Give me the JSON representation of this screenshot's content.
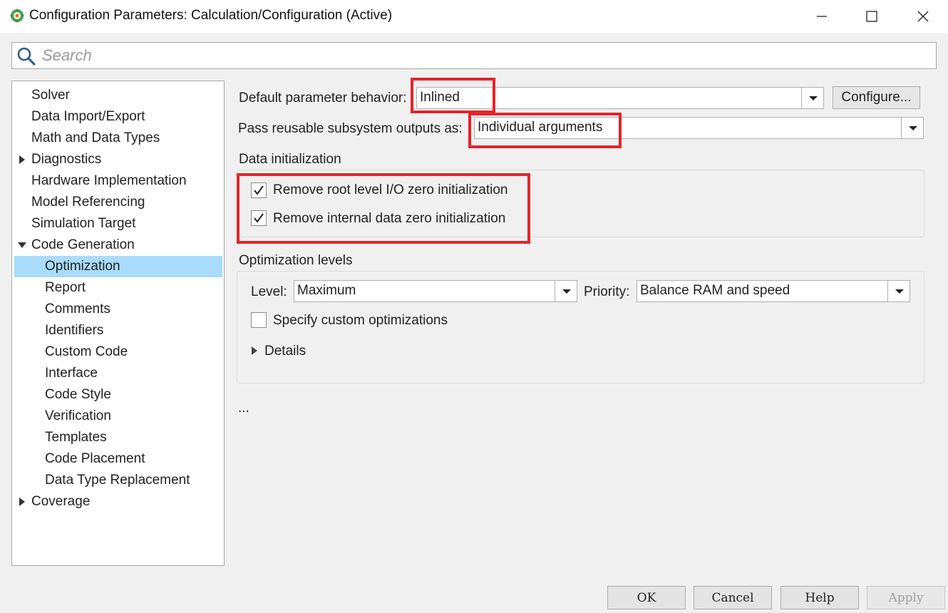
{
  "window": {
    "title": "Configuration Parameters: Calculation/Configuration (Active)",
    "minimize_icon": "minimize-icon",
    "maximize_icon": "maximize-icon",
    "close_icon": "close-icon"
  },
  "search": {
    "placeholder": "Search",
    "value": ""
  },
  "tree": {
    "items": [
      {
        "label": "Solver",
        "level": 0,
        "expander": "none"
      },
      {
        "label": "Data Import/Export",
        "level": 0,
        "expander": "none"
      },
      {
        "label": "Math and Data Types",
        "level": 0,
        "expander": "none"
      },
      {
        "label": "Diagnostics",
        "level": 0,
        "expander": "collapsed"
      },
      {
        "label": "Hardware Implementation",
        "level": 0,
        "expander": "none"
      },
      {
        "label": "Model Referencing",
        "level": 0,
        "expander": "none"
      },
      {
        "label": "Simulation Target",
        "level": 0,
        "expander": "none"
      },
      {
        "label": "Code Generation",
        "level": 0,
        "expander": "expanded"
      },
      {
        "label": "Optimization",
        "level": 1,
        "expander": "none",
        "selected": true
      },
      {
        "label": "Report",
        "level": 1,
        "expander": "none"
      },
      {
        "label": "Comments",
        "level": 1,
        "expander": "none"
      },
      {
        "label": "Identifiers",
        "level": 1,
        "expander": "none"
      },
      {
        "label": "Custom Code",
        "level": 1,
        "expander": "none"
      },
      {
        "label": "Interface",
        "level": 1,
        "expander": "none"
      },
      {
        "label": "Code Style",
        "level": 1,
        "expander": "none"
      },
      {
        "label": "Verification",
        "level": 1,
        "expander": "none"
      },
      {
        "label": "Templates",
        "level": 1,
        "expander": "none"
      },
      {
        "label": "Code Placement",
        "level": 1,
        "expander": "none"
      },
      {
        "label": "Data Type Replacement",
        "level": 1,
        "expander": "none"
      },
      {
        "label": "Coverage",
        "level": 0,
        "expander": "collapsed"
      }
    ],
    "selected_color": "#a8dcfa"
  },
  "main": {
    "default_param": {
      "label": "Default parameter behavior:",
      "value": "Inlined",
      "configure_label": "Configure..."
    },
    "pass_reusable": {
      "label": "Pass reusable subsystem outputs as:",
      "value": "Individual arguments"
    },
    "data_init": {
      "heading": "Data initialization",
      "remove_root": {
        "label": "Remove root level I/O zero initialization",
        "checked": true
      },
      "remove_internal": {
        "label": "Remove internal data zero initialization",
        "checked": true
      }
    },
    "opt_levels": {
      "heading": "Optimization levels",
      "level_label": "Level:",
      "level_value": "Maximum",
      "priority_label": "Priority:",
      "priority_value": "Balance RAM and speed",
      "custom": {
        "label": "Specify custom optimizations",
        "checked": false
      },
      "details_label": "Details"
    },
    "more": "..."
  },
  "highlight_color": "#e3242b",
  "footer": {
    "ok": "OK",
    "cancel": "Cancel",
    "help": "Help",
    "apply": "Apply"
  }
}
